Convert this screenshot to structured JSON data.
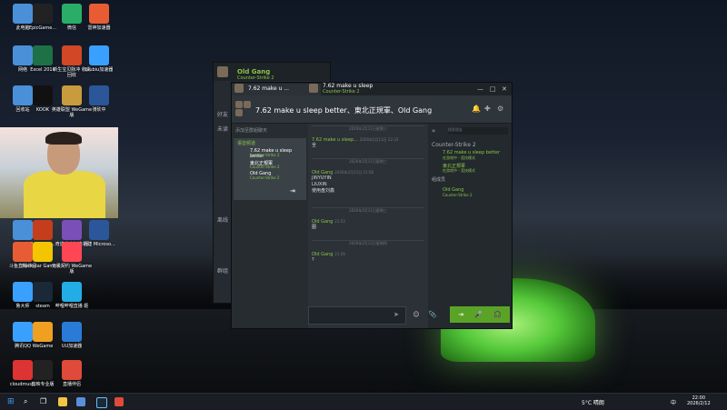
{
  "desktop": {
    "icons": [
      {
        "label": "此电脑"
      },
      {
        "label": "EpicGame..."
      },
      {
        "label": "微信"
      },
      {
        "label": "雷神加速器"
      },
      {
        "label": "网络"
      },
      {
        "label": "Excel 2016"
      },
      {
        "label": "新生宝贝脉冲\n收货回收"
      },
      {
        "label": "biubiu加速器"
      },
      {
        "label": "回收站"
      },
      {
        "label": "KOOK"
      },
      {
        "label": "英雄联盟\nWeGame版"
      },
      {
        "label": "骑砍中"
      },
      {
        "label": "QQ"
      },
      {
        "label": "PowerPoi..."
      },
      {
        "label": "奇迹电竞加速\n器"
      },
      {
        "label": "新建\nMicroso..."
      },
      {
        "label": "斗鱼直播伴侣"
      },
      {
        "label": "Rockstar\nGames..."
      },
      {
        "label": "无畏契约\nWeGame版"
      },
      {
        "label": "鲁大师"
      },
      {
        "label": "steam"
      },
      {
        "label": "哔哩哔哩直播\n姬"
      },
      {
        "label": "腾讯QQ"
      },
      {
        "label": "WeGame"
      },
      {
        "label": "UU加速器"
      },
      {
        "label": "cloudmusic"
      },
      {
        "label": "剪映专业版"
      },
      {
        "label": "直播伴侣"
      }
    ]
  },
  "back_window": {
    "title": "Old Gang",
    "subtitle": "Counter-Strike 2",
    "labels": [
      "好友",
      "未读",
      "离线",
      "群组"
    ]
  },
  "chat": {
    "tabs": [
      {
        "title": "7.62 make u ...",
        "subtitle": ""
      },
      {
        "title": "7.62 make u sleep",
        "subtitle": "Counter-Strike 2"
      }
    ],
    "group_title": "7.62 make u sleep better、東北正規軍、Old Gang",
    "left_search": "添加至群組聊天",
    "voice_header": "语音频道",
    "voice_members": [
      {
        "name": "7.62 make u sleep better",
        "sub": "Counter-Strike 2"
      },
      {
        "name": "東北正規軍",
        "sub": "Counter-Strike 2"
      },
      {
        "name": "Old Gang",
        "sub": "Counter-Strike 2"
      }
    ],
    "messages": [
      {
        "name": "7.62 make u sleep...",
        "time": "2026年2月11日 22:33",
        "lines": [
          "全"
        ]
      },
      {
        "name": "Old Gang",
        "time": "2026年2月11日 21:58",
        "lines": [
          "JINYUYIN",
          "LIUXIN",
          "使用盘刘鑫"
        ]
      },
      {
        "name": "Old Gang",
        "time": "21:53",
        "lines": [
          "图"
        ]
      },
      {
        "name": "Old Gang",
        "time": "21:59",
        "lines": [
          "?"
        ]
      }
    ],
    "separators": [
      "2026年2月11日星期三",
      "2026年2月11日星期三",
      "2026年2月11日星期三",
      "2026年2月12日星期四"
    ],
    "input_placeholder": "",
    "right_search": "搜索朋友",
    "right_group": "Counter-Strike 2",
    "right_members": [
      {
        "name": "7.62 make u sleep better",
        "status": "在游戏中 - 竞技模式"
      },
      {
        "name": "東北正規軍",
        "status": "在游戏中 - 竞技模式"
      }
    ],
    "right_group2": "组成员",
    "right_members2": [
      {
        "name": "Old Gang",
        "status": "Counter-Strike 2"
      }
    ]
  },
  "taskbar": {
    "weather": "5°C 晴朗",
    "time": "22:00",
    "date": "2026/2/12",
    "lang": "中"
  }
}
